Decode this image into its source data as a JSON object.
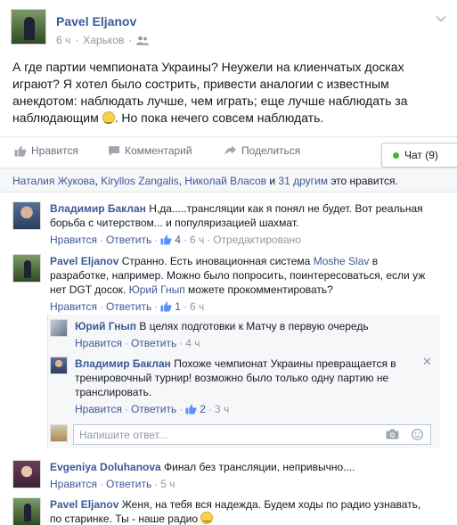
{
  "post": {
    "author": "Pavel Eljanov",
    "time": "6 ч",
    "location": "Харьков",
    "text_part1": "А где партии чемпионата Украины? Неужели на клиенчатых досках играют? Я хотел было сострить, привести аналогии с известным анекдотом: наблюдать лучше, чем играть; еще лучше наблюдать за наблюдающим ",
    "text_part2": ". Но пока нечего совсем наблюдать."
  },
  "actions": {
    "like": "Нравится",
    "comment": "Комментарий",
    "share": "Поделиться"
  },
  "chat": {
    "label": "Чат (9)"
  },
  "likes": {
    "name1": "Наталия Жукова",
    "sep1": ", ",
    "name2": "Kiryllos Zangalis",
    "sep2": ", ",
    "name3": "Николай Власов",
    "and": " и ",
    "others": "31 другим",
    "suffix": " это нравится."
  },
  "comments": [
    {
      "author": "Владимир Баклан",
      "text": " Н,да.....трансляции как я понял не будет. Вот реальная борьба с читерством... и популяризацией шахмат.",
      "like": "Нравится",
      "reply": "Ответить",
      "likes": "4",
      "time": "6 ч",
      "edited": "Отредактировано"
    },
    {
      "author": "Pavel Eljanov",
      "text_a": " Странно. Есть иновационная система ",
      "mention1": "Moshe Slav",
      "text_b": " в разработке, например. Можно было попросить, поинтересоваться, если уж нет DGT досок. ",
      "mention2": "Юрий Гнып",
      "text_c": " можете прокомментировать?",
      "like": "Нравится",
      "reply": "Ответить",
      "likes": "1",
      "time": "6 ч"
    },
    {
      "author": "Evgeniya Doluhanova",
      "text": " Финал без трансляции, непривычно....",
      "like": "Нравится",
      "reply": "Ответить",
      "time": "5 ч"
    },
    {
      "author": "Pavel Eljanov",
      "text_a": " Женя, на тебя вся надежда. Будем ходы по радио узнавать, по старинке. Ты - наше радио "
    }
  ],
  "replies": [
    {
      "author": "Юрий Гнып",
      "text": " В целях подготовки к Матчу в первую очередь",
      "like": "Нравится",
      "reply": "Ответить",
      "time": "4 ч"
    },
    {
      "author": "Владимир Баклан",
      "text": " Похоже чемпионат Украины превращается в тренировочный турнир! возможно было только одну партию не транслировать.",
      "like": "Нравится",
      "reply": "Ответить",
      "likes": "2",
      "time": "3 ч"
    }
  ],
  "reply_input": {
    "placeholder": "Напишите ответ..."
  },
  "dot": "·",
  "colors": {
    "link": "#3b5998",
    "muted": "#9197a3",
    "chat_dot": "#42b72a"
  }
}
